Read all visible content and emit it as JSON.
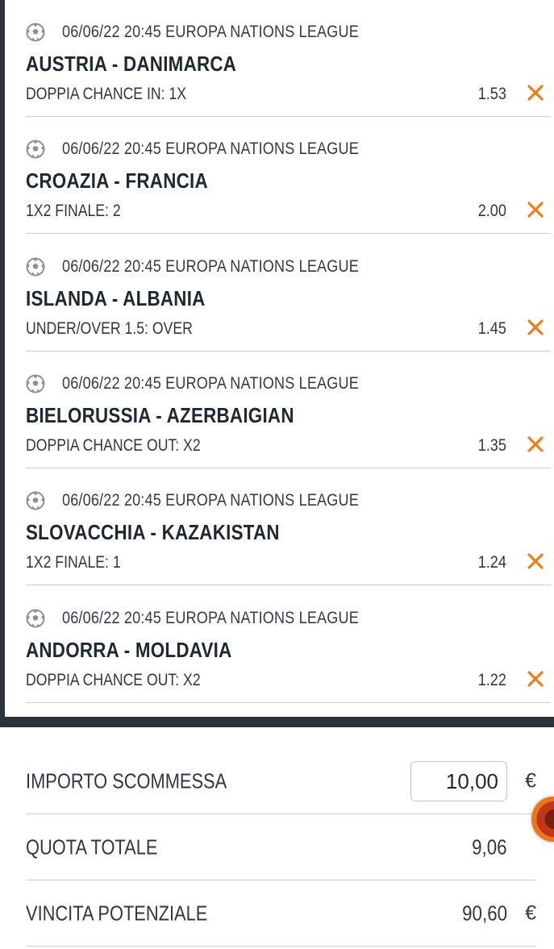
{
  "colors": {
    "accent_orange": "#f07d1a",
    "frame_dark": "#2c333d",
    "text_dark": "#1f2730"
  },
  "bets": [
    {
      "icon": "soccer-ball-icon",
      "date_time": "06/06/22 20:45",
      "competition": "EUROPA NATIONS LEAGUE",
      "match": "AUSTRIA - DANIMARCA",
      "market": "DOPPIA CHANCE IN: 1X",
      "odd": "1.53"
    },
    {
      "icon": "soccer-ball-icon",
      "date_time": "06/06/22 20:45",
      "competition": "EUROPA NATIONS LEAGUE",
      "match": "CROAZIA - FRANCIA",
      "market": "1X2 FINALE: 2",
      "odd": "2.00"
    },
    {
      "icon": "soccer-ball-icon",
      "date_time": "06/06/22 20:45",
      "competition": "EUROPA NATIONS LEAGUE",
      "match": "ISLANDA - ALBANIA",
      "market": "UNDER/OVER 1.5: OVER",
      "odd": "1.45"
    },
    {
      "icon": "soccer-ball-icon",
      "date_time": "06/06/22 20:45",
      "competition": "EUROPA NATIONS LEAGUE",
      "match": "BIELORUSSIA - AZERBAIGIAN",
      "market": "DOPPIA CHANCE OUT: X2",
      "odd": "1.35"
    },
    {
      "icon": "soccer-ball-icon",
      "date_time": "06/06/22 20:45",
      "competition": "EUROPA NATIONS LEAGUE",
      "match": "SLOVACCHIA - KAZAKISTAN",
      "market": "1X2 FINALE: 1",
      "odd": "1.24"
    },
    {
      "icon": "soccer-ball-icon",
      "date_time": "06/06/22 20:45",
      "competition": "EUROPA NATIONS LEAGUE",
      "match": "ANDORRA - MOLDAVIA",
      "market": "DOPPIA CHANCE OUT: X2",
      "odd": "1.22"
    }
  ],
  "summary": {
    "stake_label": "IMPORTO SCOMMESSA",
    "stake_value": "10,00",
    "total_odds_label": "QUOTA TOTALE",
    "total_odds_value": "9,06",
    "potential_win_label": "VINCITA POTENZIALE",
    "potential_win_value": "90,60",
    "currency": "€"
  }
}
